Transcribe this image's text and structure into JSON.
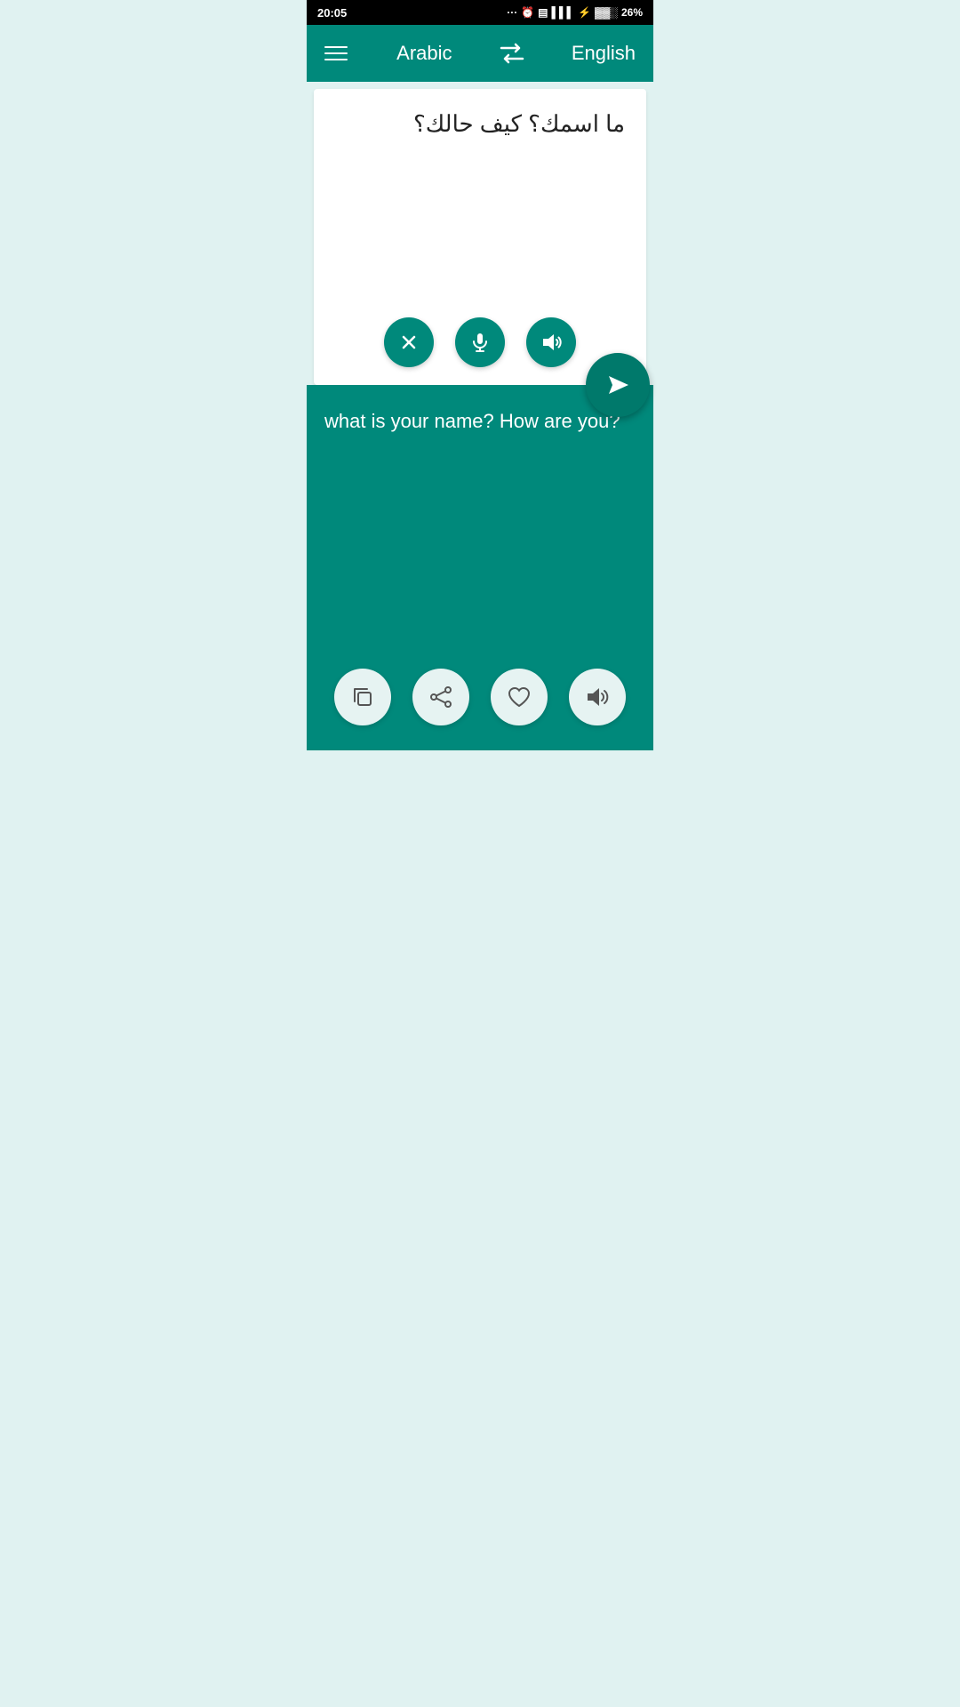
{
  "statusBar": {
    "time": "20:05",
    "battery": "26%",
    "signal": "●●●"
  },
  "navBar": {
    "sourceLanguage": "Arabic",
    "targetLanguage": "English"
  },
  "inputSection": {
    "arabicText": "ما اسمك؟ كيف حالك؟"
  },
  "outputSection": {
    "translatedText": "what is your name? How are you?"
  },
  "buttons": {
    "clear": "clear-button",
    "mic": "mic-button",
    "speakerInput": "speaker-input-button",
    "send": "send-button",
    "copy": "copy-button",
    "share": "share-button",
    "favorite": "favorite-button",
    "speakerOutput": "speaker-output-button"
  }
}
